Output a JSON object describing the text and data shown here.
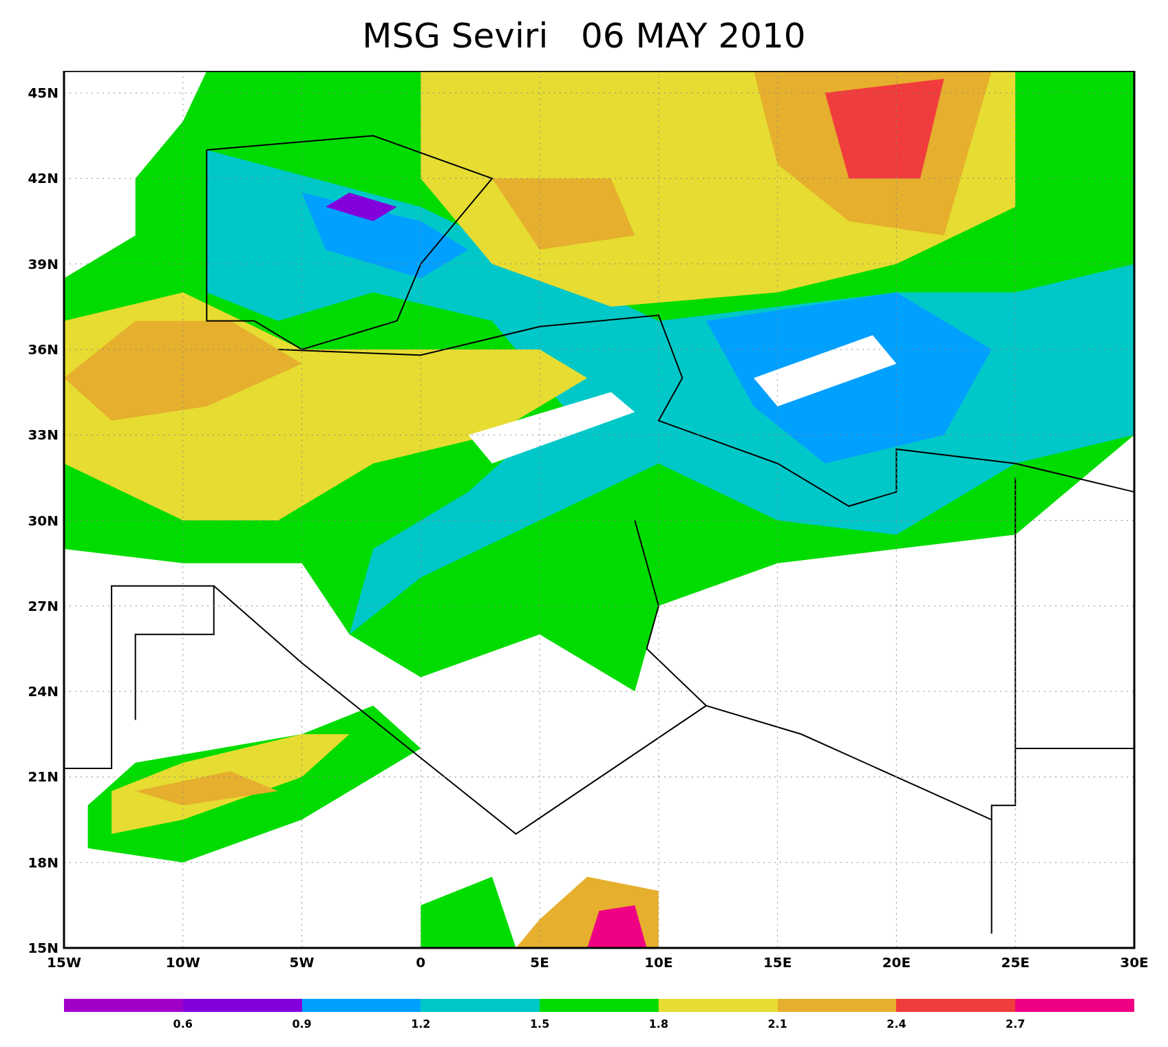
{
  "title": "MSG Seviri   06 MAY 2010",
  "lat_labels": [
    "45N",
    "42N",
    "39N",
    "36N",
    "33N",
    "30N",
    "27N",
    "24N",
    "21N",
    "18N",
    "15N"
  ],
  "lon_labels": [
    "15W",
    "10W",
    "5W",
    "0",
    "5E",
    "10E",
    "15E",
    "20E",
    "25E",
    "30E"
  ],
  "legend": {
    "bins": [
      {
        "color": "#a000c8"
      },
      {
        "color": "#8200dc"
      },
      {
        "color": "#00a0ff"
      },
      {
        "color": "#00c8c8"
      },
      {
        "color": "#00dc00"
      },
      {
        "color": "#e6dc32"
      },
      {
        "color": "#e6af2d"
      },
      {
        "color": "#f03c3c"
      },
      {
        "color": "#f00082"
      }
    ],
    "labels": [
      "0.6",
      "0.9",
      "1.2",
      "1.5",
      "1.8",
      "2.1",
      "2.4",
      "2.7"
    ]
  }
}
